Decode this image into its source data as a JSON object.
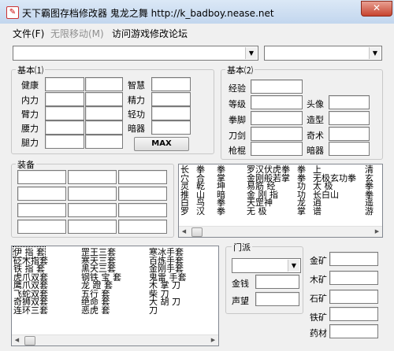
{
  "window": {
    "title": "天下霸图存档修改器 鬼龙之舞 http://k_badboy.nease.net",
    "close_label": "✕"
  },
  "menu": [
    {
      "label": "文件(F)"
    },
    {
      "label": "无限移动(M)"
    },
    {
      "label": "访问游戏修改论坛"
    }
  ],
  "basic1": {
    "title": "基本⑴",
    "left_labels": [
      "健康",
      "内力",
      "臂力",
      "腰力",
      "腿力"
    ],
    "right_labels": [
      "智慧",
      "精力",
      "轻功",
      "暗器"
    ],
    "max_button": "MAX"
  },
  "basic2": {
    "title": "基本⑵",
    "left_labels": [
      "经验",
      "等级",
      "拳脚",
      "刀剑",
      "枪棍"
    ],
    "right_labels": [
      "头像",
      "造型",
      "奇术",
      "暗器"
    ]
  },
  "equipment": {
    "title": "装备"
  },
  "skills_list": {
    "col1": [
      "长",
      "穴",
      "灵",
      "推",
      "白",
      "罗"
    ],
    "col2": [
      "拳",
      "合",
      "乾",
      "山",
      "鸟",
      "汉"
    ],
    "col3": [
      "拳",
      "掌",
      "坤",
      "暗",
      "拳",
      "拳"
    ],
    "col4": [
      "罗汉伏虎拳",
      "金刚般若掌",
      "易筋 经",
      "金 刚 指",
      "天罡神",
      "无 极"
    ],
    "col5": [
      "拳",
      "拳",
      "功",
      "功",
      "龙",
      "掌"
    ],
    "col6": [
      "上",
      "无极玄功拳",
      "太 极",
      "长白山",
      "逍",
      "谱"
    ],
    "col7": [
      "清",
      "玄",
      "拳",
      "拳",
      "遥",
      "游"
    ]
  },
  "items_list": {
    "col1": [
      "伊  指  套",
      "砭木指套",
      "铁  指  套",
      "虎爪双套",
      "鹰爪双套",
      "飞蛇双套",
      "奇狮双套",
      "连环三套"
    ],
    "col2": [
      "罡王三套",
      "寒天三套",
      "黑天三套",
      "钢铁  宝  套",
      "龙  蹬  套",
      "五行  套",
      "绝命  套",
      "恶虎  套"
    ],
    "col3": [
      "寒冰手套",
      "百炼手套",
      "金刚手套",
      "鬼雷  手套",
      "木  掌  刀",
      "柴  刀",
      "大  胡  刀",
      "刀"
    ]
  },
  "faction": {
    "title": "门派",
    "fields": [
      "金钱",
      "声望"
    ],
    "mines": [
      "金矿",
      "木矿",
      "石矿",
      "铁矿",
      "药材"
    ]
  }
}
